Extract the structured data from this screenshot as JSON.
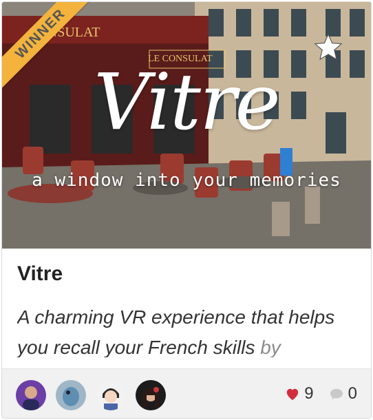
{
  "ribbon": {
    "label": "WINNER",
    "color": "#f3b33c"
  },
  "hero": {
    "title": "Vitre",
    "tagline": "a window into your memories",
    "signs": [
      "CONSULAT",
      "LE CONSULAT"
    ]
  },
  "card": {
    "title": "Vitre",
    "description_main": "A charming VR experience that helps you recall your French skills",
    "description_faded": "by"
  },
  "footer": {
    "likes": "9",
    "comments": "0",
    "like_color": "#d22c3c"
  },
  "icons": [
    "star-icon",
    "heart-icon",
    "comment-icon"
  ]
}
